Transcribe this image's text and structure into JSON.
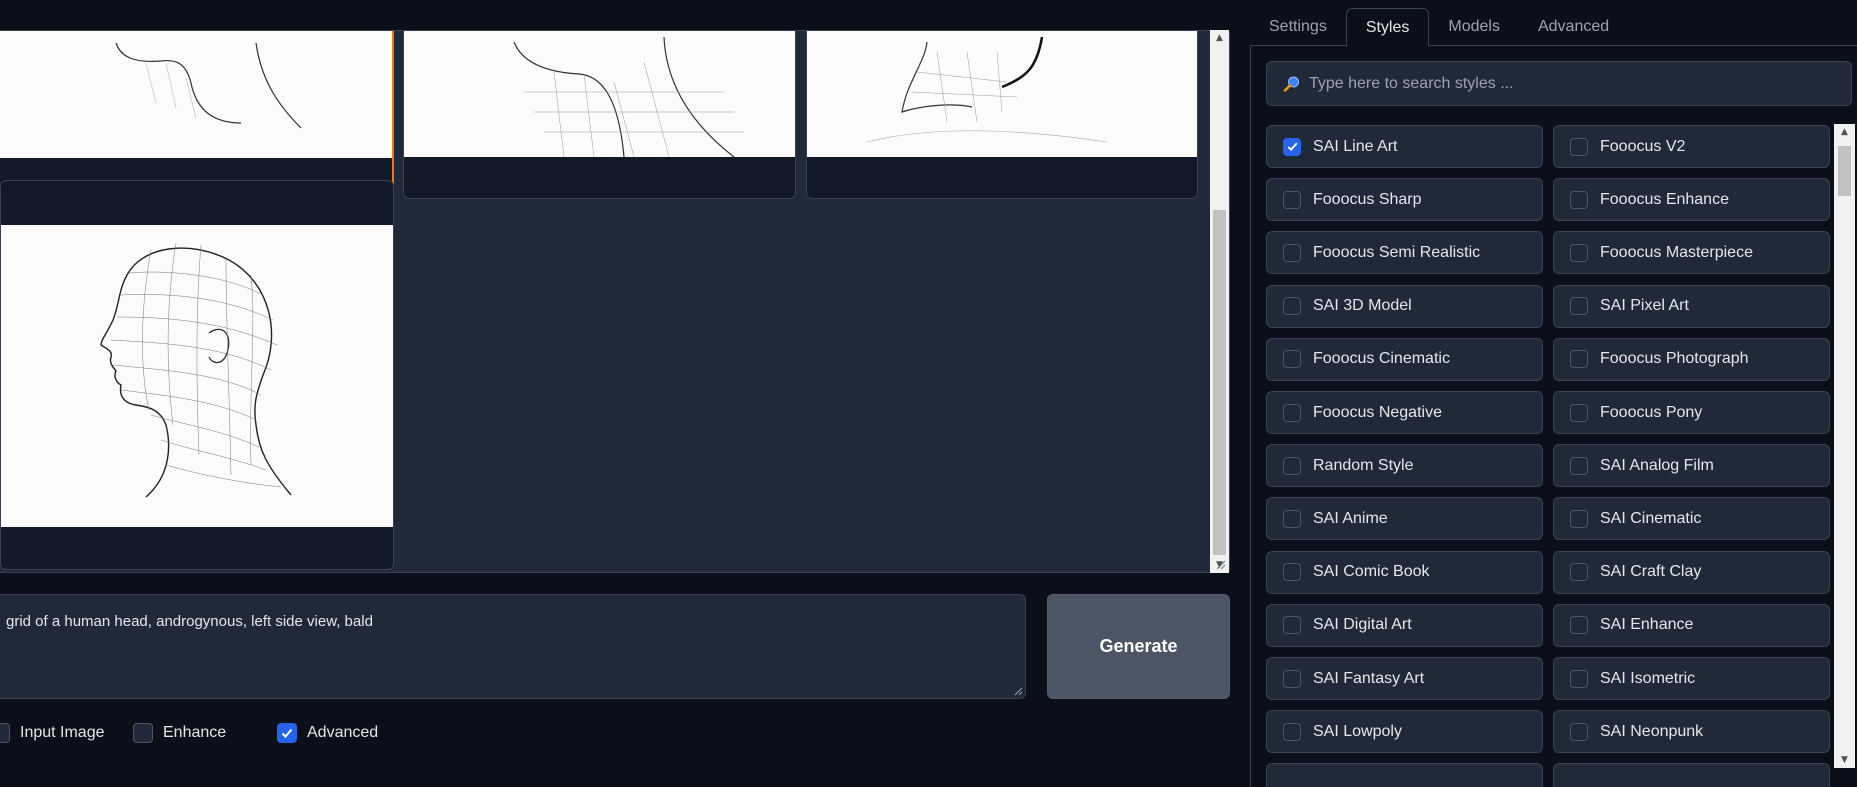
{
  "gallery": {
    "items": [
      {
        "name": "gallery-image-1",
        "selected": true
      },
      {
        "name": "gallery-image-2",
        "selected": false
      },
      {
        "name": "gallery-image-3",
        "selected": false
      },
      {
        "name": "gallery-image-4",
        "selected": false
      }
    ]
  },
  "prompt": {
    "value": "grid of a human head, androgynous, left side view, bald"
  },
  "generate_label": "Generate",
  "options": [
    {
      "label": "Input Image",
      "checked": false
    },
    {
      "label": "Enhance",
      "checked": false
    },
    {
      "label": "Advanced",
      "checked": true
    }
  ],
  "tabs": [
    {
      "label": "Settings",
      "active": false
    },
    {
      "label": "Styles",
      "active": true
    },
    {
      "label": "Models",
      "active": false
    },
    {
      "label": "Advanced",
      "active": false
    }
  ],
  "search": {
    "placeholder": "Type here to search styles ..."
  },
  "styles": [
    {
      "label": "SAI Line Art",
      "checked": true
    },
    {
      "label": "Fooocus V2",
      "checked": false
    },
    {
      "label": "Fooocus Sharp",
      "checked": false
    },
    {
      "label": "Fooocus Enhance",
      "checked": false
    },
    {
      "label": "Fooocus Semi Realistic",
      "checked": false
    },
    {
      "label": "Fooocus Masterpiece",
      "checked": false
    },
    {
      "label": "SAI 3D Model",
      "checked": false
    },
    {
      "label": "SAI Pixel Art",
      "checked": false
    },
    {
      "label": "Fooocus Cinematic",
      "checked": false
    },
    {
      "label": "Fooocus Photograph",
      "checked": false
    },
    {
      "label": "Fooocus Negative",
      "checked": false
    },
    {
      "label": "Fooocus Pony",
      "checked": false
    },
    {
      "label": "Random Style",
      "checked": false
    },
    {
      "label": "SAI Analog Film",
      "checked": false
    },
    {
      "label": "SAI Anime",
      "checked": false
    },
    {
      "label": "SAI Cinematic",
      "checked": false
    },
    {
      "label": "SAI Comic Book",
      "checked": false
    },
    {
      "label": "SAI Craft Clay",
      "checked": false
    },
    {
      "label": "SAI Digital Art",
      "checked": false
    },
    {
      "label": "SAI Enhance",
      "checked": false
    },
    {
      "label": "SAI Fantasy Art",
      "checked": false
    },
    {
      "label": "SAI Isometric",
      "checked": false
    },
    {
      "label": "SAI Lowpoly",
      "checked": false
    },
    {
      "label": "SAI Neonpunk",
      "checked": false
    }
  ],
  "colors": {
    "accent": "#f97316",
    "checkbox_on": "#2563eb",
    "background": "#0b0f19",
    "surface": "#1f2937"
  }
}
